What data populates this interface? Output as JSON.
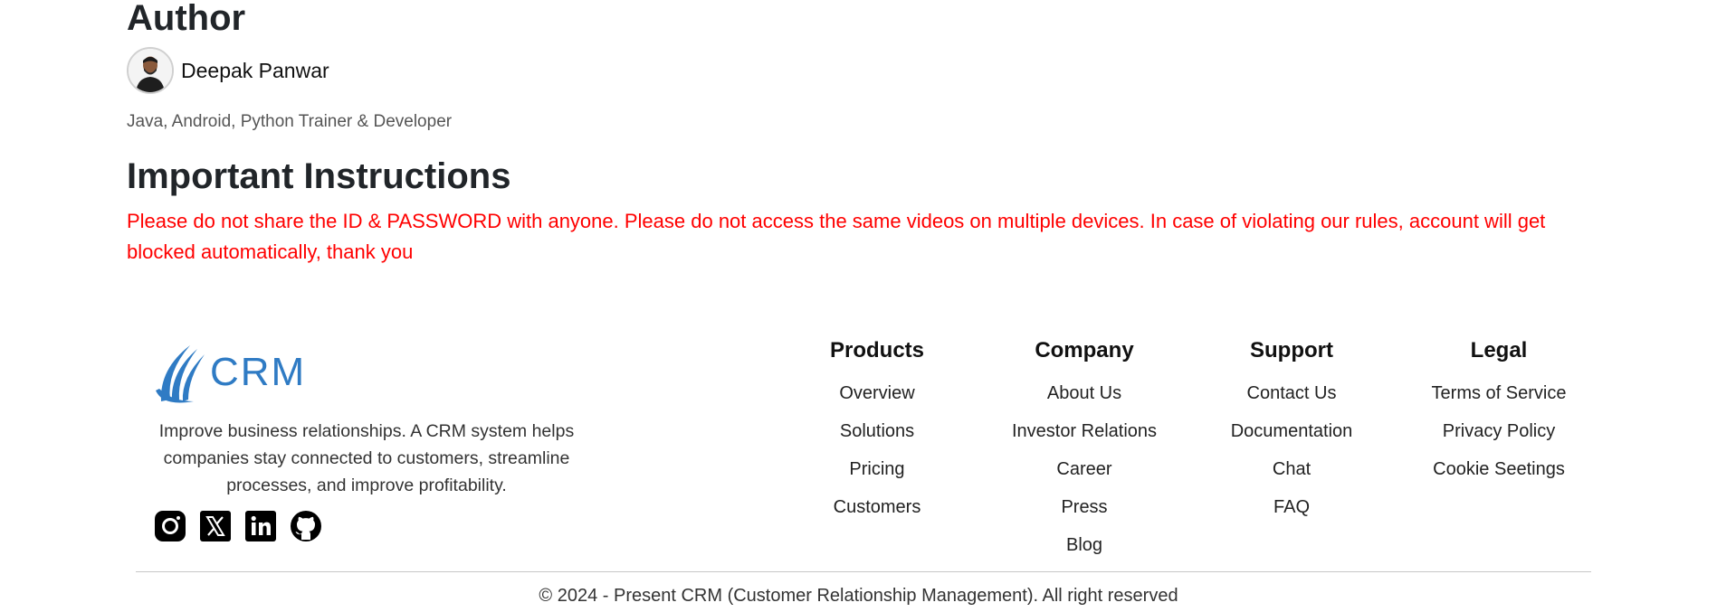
{
  "author": {
    "heading": "Author",
    "name": "Deepak Panwar",
    "bio": "Java, Android, Python Trainer & Developer"
  },
  "instructions": {
    "heading": "Important Instructions",
    "text": "Please do not share the ID & PASSWORD with anyone. Please do not access the same videos on multiple devices. In case of violating our rules, account will get blocked automatically, thank you"
  },
  "footer": {
    "logo_text": "CRM",
    "description": "Improve business relationships. A CRM system helps companies stay connected to customers, streamline processes, and improve profitability.",
    "social_icons": [
      "instagram-icon",
      "x-icon",
      "linkedin-icon",
      "github-icon"
    ],
    "columns": [
      {
        "title": "Products",
        "links": [
          "Overview",
          "Solutions",
          "Pricing",
          "Customers"
        ]
      },
      {
        "title": "Company",
        "links": [
          "About Us",
          "Investor Relations",
          "Career",
          "Press",
          "Blog"
        ]
      },
      {
        "title": "Support",
        "links": [
          "Contact Us",
          "Documentation",
          "Chat",
          "FAQ"
        ]
      },
      {
        "title": "Legal",
        "links": [
          "Terms of Service",
          "Privacy Policy",
          "Cookie Seetings"
        ]
      }
    ],
    "copyright": "© 2024 - Present CRM (Customer Relationship Management). All right reserved"
  },
  "colors": {
    "accent": "#2f7bc4",
    "warning_text": "#ff0000"
  }
}
